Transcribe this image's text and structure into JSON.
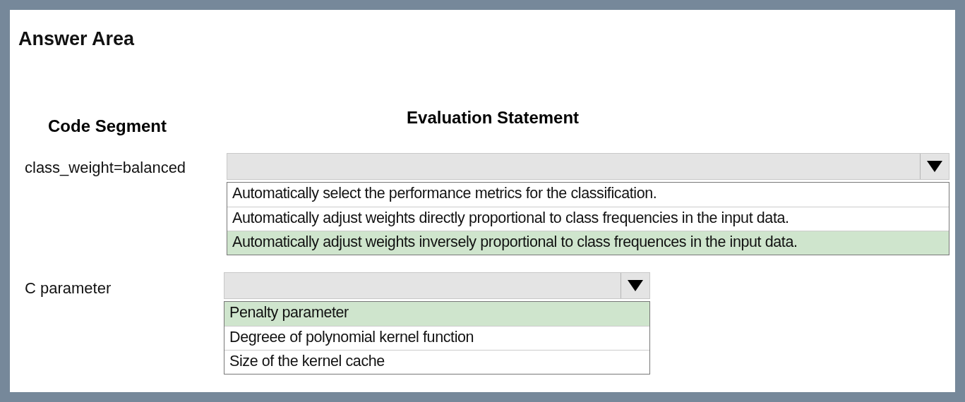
{
  "title": "Answer Area",
  "headers": {
    "code_segment": "Code Segment",
    "evaluation_statement": "Evaluation Statement"
  },
  "rows": [
    {
      "label": "class_weight=balanced",
      "options": [
        {
          "text": "Automatically select the performance metrics for the classification.",
          "selected": false
        },
        {
          "text": "Automatically adjust weights directly proportional to class frequencies in the input data.",
          "selected": false
        },
        {
          "text": "Automatically adjust weights inversely proportional to class frequences in the input data.",
          "selected": true
        }
      ]
    },
    {
      "label": "C parameter",
      "options": [
        {
          "text": "Penalty parameter",
          "selected": true
        },
        {
          "text": "Degreee of polynomial kernel function",
          "selected": false
        },
        {
          "text": "Size of the kernel cache",
          "selected": false
        }
      ]
    }
  ]
}
